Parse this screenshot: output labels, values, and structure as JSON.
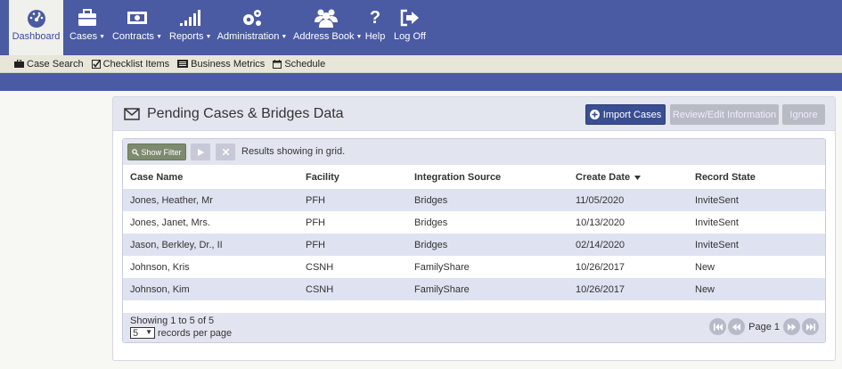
{
  "nav": {
    "items": [
      {
        "label": "Dashboard",
        "icon": "dashboard-icon",
        "caret": ""
      },
      {
        "label": "Cases",
        "icon": "briefcase-icon",
        "caret": "▼"
      },
      {
        "label": "Contracts",
        "icon": "money-icon",
        "caret": "▼"
      },
      {
        "label": "Reports",
        "icon": "bar-chart-icon",
        "caret": "▼"
      },
      {
        "label": "Administration",
        "icon": "gears-icon",
        "caret": "▼"
      },
      {
        "label": "Address Book",
        "icon": "users-icon",
        "caret": "▼"
      },
      {
        "label": "Help",
        "icon": "question-icon",
        "caret": ""
      },
      {
        "label": "Log Off",
        "icon": "logout-icon",
        "caret": ""
      }
    ]
  },
  "subnav": {
    "items": [
      {
        "label": "Case Search",
        "icon": "briefcase-icon"
      },
      {
        "label": "Checklist Items",
        "icon": "checkbox-icon"
      },
      {
        "label": "Business Metrics",
        "icon": "metrics-icon"
      },
      {
        "label": "Schedule",
        "icon": "calendar-icon"
      }
    ]
  },
  "panel": {
    "title": "Pending Cases & Bridges Data",
    "import_label": "Import Cases",
    "review_label": "Review/Edit Information",
    "ignore_label": "Ignore"
  },
  "grid": {
    "toolbar": {
      "filter_label": "Show Filter",
      "status_text": "Results showing in grid."
    },
    "columns": [
      "Case Name",
      "Facility",
      "Integration Source",
      "Create Date",
      "Record State"
    ],
    "rows": [
      [
        "Jones, Heather, Mr",
        "PFH",
        "Bridges",
        "11/05/2020",
        "InviteSent"
      ],
      [
        "Jones, Janet, Mrs.",
        "PFH",
        "Bridges",
        "10/13/2020",
        "InviteSent"
      ],
      [
        "Jason, Berkley, Dr., II",
        "PFH",
        "Bridges",
        "02/14/2020",
        "InviteSent"
      ],
      [
        "Johnson, Kris",
        "CSNH",
        "FamilyShare",
        "10/26/2017",
        "New"
      ],
      [
        "Johnson, Kim",
        "CSNH",
        "FamilyShare",
        "10/26/2017",
        "New"
      ]
    ],
    "footer": {
      "showing": "Showing 1 to 5 of 5",
      "per_page_value": "5",
      "per_page_label": "records per page",
      "page_label": "Page 1"
    }
  },
  "colors": {
    "nav": "#4a5aa3",
    "row_alt": "#dfe3f1",
    "import": "#3a4f92"
  }
}
